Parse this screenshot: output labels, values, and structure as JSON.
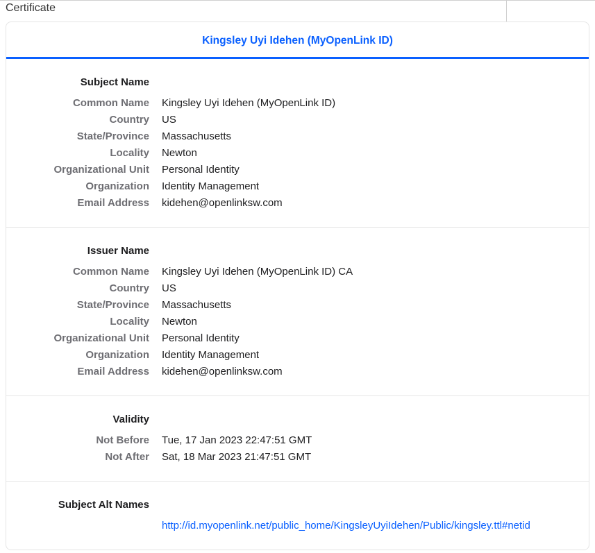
{
  "windowTitle": "Certificate",
  "header": {
    "linkText": "Kingsley Uyi Idehen (MyOpenLink ID)"
  },
  "sections": {
    "subjectName": {
      "heading": "Subject Name",
      "fields": {
        "commonNameLabel": "Common Name",
        "commonName": "Kingsley Uyi Idehen (MyOpenLink ID)",
        "countryLabel": "Country",
        "country": "US",
        "stateLabel": "State/Province",
        "state": "Massachusetts",
        "localityLabel": "Locality",
        "locality": "Newton",
        "ouLabel": "Organizational Unit",
        "ou": "Personal Identity",
        "orgLabel": "Organization",
        "org": "Identity Management",
        "emailLabel": "Email Address",
        "email": "kidehen@openlinksw.com"
      }
    },
    "issuerName": {
      "heading": "Issuer Name",
      "fields": {
        "commonNameLabel": "Common Name",
        "commonName": "Kingsley Uyi Idehen (MyOpenLink ID) CA",
        "countryLabel": "Country",
        "country": "US",
        "stateLabel": "State/Province",
        "state": "Massachusetts",
        "localityLabel": "Locality",
        "locality": "Newton",
        "ouLabel": "Organizational Unit",
        "ou": "Personal Identity",
        "orgLabel": "Organization",
        "org": "Identity Management",
        "emailLabel": "Email Address",
        "email": "kidehen@openlinksw.com"
      }
    },
    "validity": {
      "heading": "Validity",
      "fields": {
        "notBeforeLabel": "Not Before",
        "notBefore": "Tue, 17 Jan 2023 22:47:51 GMT",
        "notAfterLabel": "Not After",
        "notAfter": "Sat, 18 Mar 2023 21:47:51 GMT"
      }
    },
    "san": {
      "heading": "Subject Alt Names",
      "url": "http://id.myopenlink.net/public_home/KingsleyUyiIdehen/Public/kingsley.ttl#netid"
    }
  }
}
